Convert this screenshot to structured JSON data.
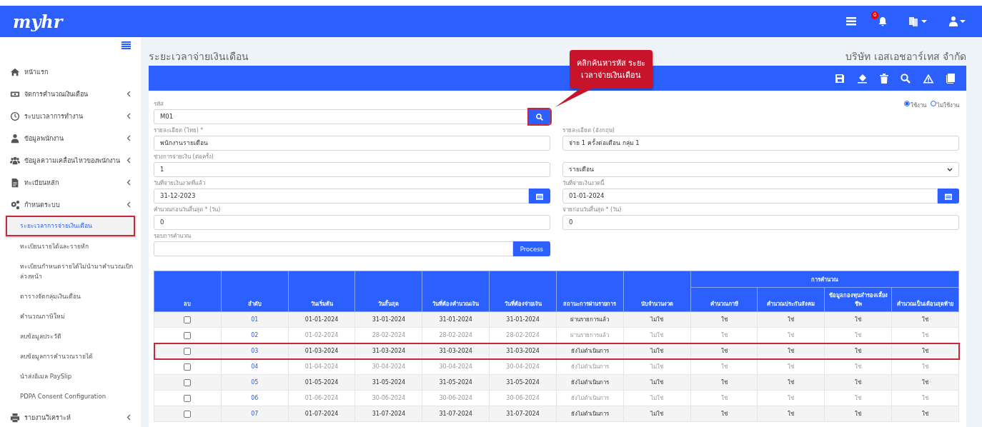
{
  "topbar": {
    "logo": "myhr",
    "notification_count": "0"
  },
  "sidebar": {
    "items": [
      {
        "label": "หน้าแรก",
        "has_arrow": false,
        "selected": false
      },
      {
        "label": "จัดการคำนวณเงินเดือน",
        "has_arrow": true,
        "selected": false
      },
      {
        "label": "ระบบเวลาการทำงาน",
        "has_arrow": true,
        "selected": false
      },
      {
        "label": "ข้อมูลพนักงาน",
        "has_arrow": true,
        "selected": false
      },
      {
        "label": "ข้อมูลความเคลื่อนไหวของพนักงาน",
        "has_arrow": true,
        "selected": false
      },
      {
        "label": "ทะเบียนหลัก",
        "has_arrow": true,
        "selected": false
      },
      {
        "label": "กำหนดระบบ",
        "has_arrow": true,
        "selected": false,
        "children": [
          {
            "label": "ระยะเวลาการจ่ายเงินเดือน",
            "selected": true
          },
          {
            "label": "ทะเบียนรายได้และรายหัก",
            "selected": false
          },
          {
            "label": "ทะเบียนกำหนดรายได้ไม่นำมาคำนวณเบิกล่วงหน้า",
            "selected": false
          },
          {
            "label": "ตารางจัดกลุ่มเงินเดือน",
            "selected": false
          },
          {
            "label": "คำนวณภาษีใหม่",
            "selected": false
          },
          {
            "label": "ลบข้อมูลประวัติ",
            "selected": false
          },
          {
            "label": "ลบข้อมูลการคำนวณรายได้",
            "selected": false
          },
          {
            "label": "นำส่งอีเมล PaySlip",
            "selected": false
          },
          {
            "label": "PDPA Consent Configuration",
            "selected": false
          }
        ]
      },
      {
        "label": "รายงานวิเคราะห์",
        "has_arrow": true,
        "selected": false
      }
    ]
  },
  "page": {
    "title": "ระยะเวลาจ่ายเงินเดือน",
    "company": "บริษัท เอสเอชอาร์เทส จำกัด"
  },
  "callout": "คลิกค้นหารหัส ระยะเวลาจ่ายเงินเดือน",
  "form": {
    "code": {
      "label": "รหัส",
      "value": "M01"
    },
    "status": [
      {
        "label": "ใช้งาน",
        "selected": true
      },
      {
        "label": "ไม่ใช้งาน",
        "selected": false
      }
    ],
    "desc_th": {
      "label": "รายละเอียด (ไทย) *",
      "value": "พนักงานรายเดือน"
    },
    "desc_en": {
      "label": "รายละเอียด (อังกฤษ)",
      "value": "จ่าย 1 ครั้งต่อเดือน กลุ่ม 1"
    },
    "period": {
      "label": "ช่วงการจ่ายเงิน (ต่อครั้ง)",
      "value": "1"
    },
    "period_unit": {
      "value": "รายเดือน"
    },
    "last_pay_date": {
      "label": "วันที่จ่ายเงินงวดที่แล้ว",
      "value": "31-12-2023"
    },
    "this_pay_date": {
      "label": "วันที่จ่ายเงินงวดนี้",
      "value": "01-01-2024"
    },
    "calc_before": {
      "label": "คำนวณก่อนวันสิ้นสุด * (วัน)",
      "value": "0"
    },
    "pay_before": {
      "label": "จ่ายก่อนวันสิ้นสุด * (วัน)",
      "value": "0"
    },
    "cycle": {
      "label": "รอบการคำนวณ",
      "button": "Process"
    }
  },
  "table": {
    "columns": [
      "ลบ",
      "ลำดับ",
      "วันเริ่มต้น",
      "วันสิ้นสุด",
      "วันที่ต้องคำนวณเงิน",
      "วันที่ต้องจ่ายเงิน",
      "สถานะการผ่านรายการ",
      "นับจำนวนงวด"
    ],
    "group": {
      "label": "การคำนวณ",
      "columns": [
        "คำนวณภาษี",
        "คำนวณประกันสังคม",
        "ข้อมูลกองทุนสำรองเลี้ยงชีพ",
        "คำนวณเป็นเดือนสุดท้าย"
      ]
    },
    "rows": [
      {
        "checked": false,
        "highlighted": false,
        "cells": [
          "",
          "01",
          "01-01-2024",
          "31-01-2024",
          "31-01-2024",
          "31-01-2024",
          "ผ่านรายการแล้ว",
          "ไม่ใช่",
          "ใช่",
          "ใช่",
          "ใช่",
          "ใช่"
        ]
      },
      {
        "checked": false,
        "highlighted": false,
        "cells": [
          "",
          "02",
          "01-02-2024",
          "28-02-2024",
          "28-02-2024",
          "28-02-2024",
          "ผ่านรายการแล้ว",
          "ไม่ใช่",
          "ใช่",
          "ใช่",
          "ใช่",
          "ใช่"
        ]
      },
      {
        "checked": false,
        "highlighted": true,
        "cells": [
          "",
          "03",
          "01-03-2024",
          "31-03-2024",
          "31-03-2024",
          "31-03-2024",
          "ยังไม่ดำเนินการ",
          "ไม่ใช่",
          "ใช่",
          "ใช่",
          "ใช่",
          "ใช่"
        ]
      },
      {
        "checked": false,
        "highlighted": false,
        "cells": [
          "",
          "04",
          "01-04-2024",
          "30-04-2024",
          "30-04-2024",
          "30-04-2024",
          "ยังไม่ดำเนินการ",
          "ไม่ใช่",
          "ใช่",
          "ใช่",
          "ใช่",
          "ใช่"
        ]
      },
      {
        "checked": false,
        "highlighted": false,
        "cells": [
          "",
          "05",
          "01-05-2024",
          "31-05-2024",
          "31-05-2024",
          "31-05-2024",
          "ยังไม่ดำเนินการ",
          "ไม่ใช่",
          "ใช่",
          "ใช่",
          "ใช่",
          "ใช่"
        ]
      },
      {
        "checked": false,
        "highlighted": false,
        "cells": [
          "",
          "06",
          "01-06-2024",
          "30-06-2024",
          "30-06-2024",
          "30-06-2024",
          "ยังไม่ดำเนินการ",
          "ไม่ใช่",
          "ใช่",
          "ใช่",
          "ใช่",
          "ใช่"
        ]
      },
      {
        "checked": false,
        "highlighted": false,
        "cells": [
          "",
          "07",
          "01-07-2024",
          "31-07-2024",
          "31-07-2024",
          "31-07-2024",
          "ยังไม่ดำเนินการ",
          "ไม่ใช่",
          "ใช่",
          "ใช่",
          "ใช่",
          "ใช่"
        ]
      }
    ]
  }
}
